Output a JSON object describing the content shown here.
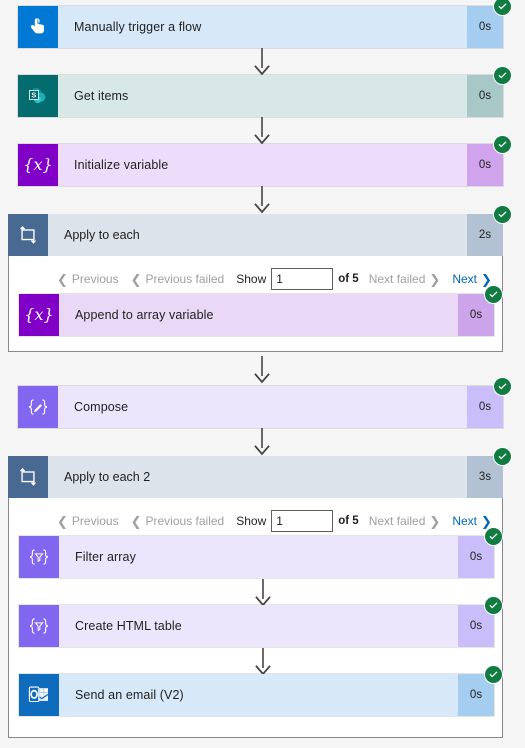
{
  "flow": {
    "background_color": "#f5f5f5",
    "success_color": "#107c41",
    "link_color": "#0067b8",
    "disabled_color": "#a19f9d"
  },
  "steps": [
    {
      "name": "manually-trigger-a-flow",
      "label": "Manually trigger a flow",
      "duration": "0s",
      "status": "succeeded",
      "icon": "tap-hand-icon",
      "theme": "t-trigger"
    },
    {
      "name": "get-items",
      "label": "Get items",
      "duration": "0s",
      "status": "succeeded",
      "icon": "sharepoint-icon",
      "theme": "t-sharepoint"
    },
    {
      "name": "initialize-variable",
      "label": "Initialize variable",
      "duration": "0s",
      "status": "succeeded",
      "icon": "variable-braces-x-icon",
      "theme": "t-variable"
    },
    {
      "name": "apply-to-each",
      "label": "Apply to each",
      "duration": "2s",
      "status": "succeeded",
      "icon": "loop-foreach-icon",
      "theme": "t-loop"
    },
    {
      "name": "append-to-array-variable",
      "label": "Append to array variable",
      "duration": "0s",
      "status": "succeeded",
      "icon": "variable-braces-x-icon",
      "theme": "t-variable2"
    },
    {
      "name": "compose",
      "label": "Compose",
      "duration": "0s",
      "status": "succeeded",
      "icon": "compose-pencil-icon",
      "theme": "t-data"
    },
    {
      "name": "apply-to-each-2",
      "label": "Apply to each 2",
      "duration": "3s",
      "status": "succeeded",
      "icon": "loop-foreach-icon",
      "theme": "t-loop"
    },
    {
      "name": "filter-array",
      "label": "Filter array",
      "duration": "0s",
      "status": "succeeded",
      "icon": "filter-funnel-icon",
      "theme": "t-data"
    },
    {
      "name": "create-html-table",
      "label": "Create HTML table",
      "duration": "0s",
      "status": "succeeded",
      "icon": "filter-funnel-icon",
      "theme": "t-data"
    },
    {
      "name": "send-an-email-v2",
      "label": "Send an email (V2)",
      "duration": "0s",
      "status": "succeeded",
      "icon": "outlook-icon",
      "theme": "t-outlook"
    }
  ],
  "pagers": [
    {
      "previous": "Previous",
      "previous_failed": "Previous failed",
      "show_label": "Show",
      "current_page": "1",
      "of_label": "of 5",
      "next_failed": "Next failed",
      "next": "Next"
    },
    {
      "previous": "Previous",
      "previous_failed": "Previous failed",
      "show_label": "Show",
      "current_page": "1",
      "of_label": "of 5",
      "next_failed": "Next failed",
      "next": "Next"
    }
  ]
}
